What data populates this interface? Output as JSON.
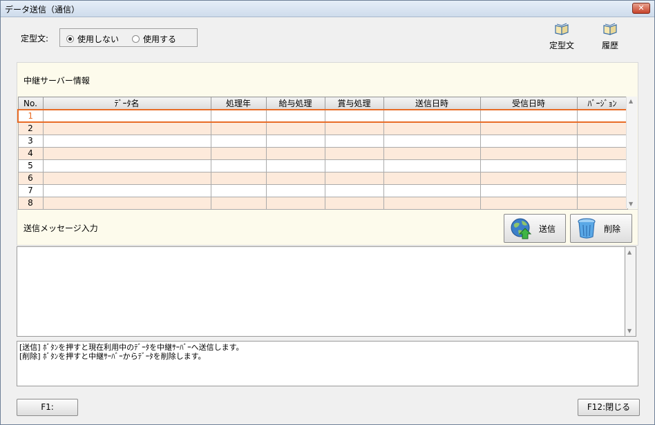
{
  "window": {
    "title": "データ送信（通信）",
    "close_glyph": "✕"
  },
  "template_option": {
    "label": "定型文:",
    "options": [
      {
        "label": "使用しない",
        "selected": true
      },
      {
        "label": "使用する",
        "selected": false
      }
    ]
  },
  "toolbar": {
    "items": [
      {
        "label": "定型文",
        "icon": "book-icon"
      },
      {
        "label": "履歴",
        "icon": "book-icon"
      }
    ]
  },
  "server_info": {
    "header": "中継サーバー情報",
    "columns": [
      "No.",
      "ﾃﾞｰﾀ名",
      "処理年",
      "給与処理",
      "賞与処理",
      "送信日時",
      "受信日時",
      "ﾊﾞｰｼﾞｮﾝ"
    ],
    "rows": [
      {
        "no": "1",
        "selected": true
      },
      {
        "no": "2"
      },
      {
        "no": "3"
      },
      {
        "no": "4"
      },
      {
        "no": "5"
      },
      {
        "no": "6"
      },
      {
        "no": "7"
      },
      {
        "no": "8"
      }
    ]
  },
  "message": {
    "header": "送信メッセージ入力",
    "send_label": "送信",
    "delete_label": "削除",
    "text": ""
  },
  "info": {
    "text": "[送信] ﾎﾞﾀﾝを押すと現在利用中のﾃﾞｰﾀを中継ｻｰﾊﾞｰへ送信します。\n[削除] ﾎﾞﾀﾝを押すと中継ｻｰﾊﾞｰからﾃﾞｰﾀを削除します。"
  },
  "footer": {
    "f1_label": "F1:",
    "f12_label": "F12:閉じる"
  },
  "colors": {
    "selected_row": "#e86b25",
    "alt_row": "#fdeadb",
    "panel_bg": "#fdfbec"
  }
}
